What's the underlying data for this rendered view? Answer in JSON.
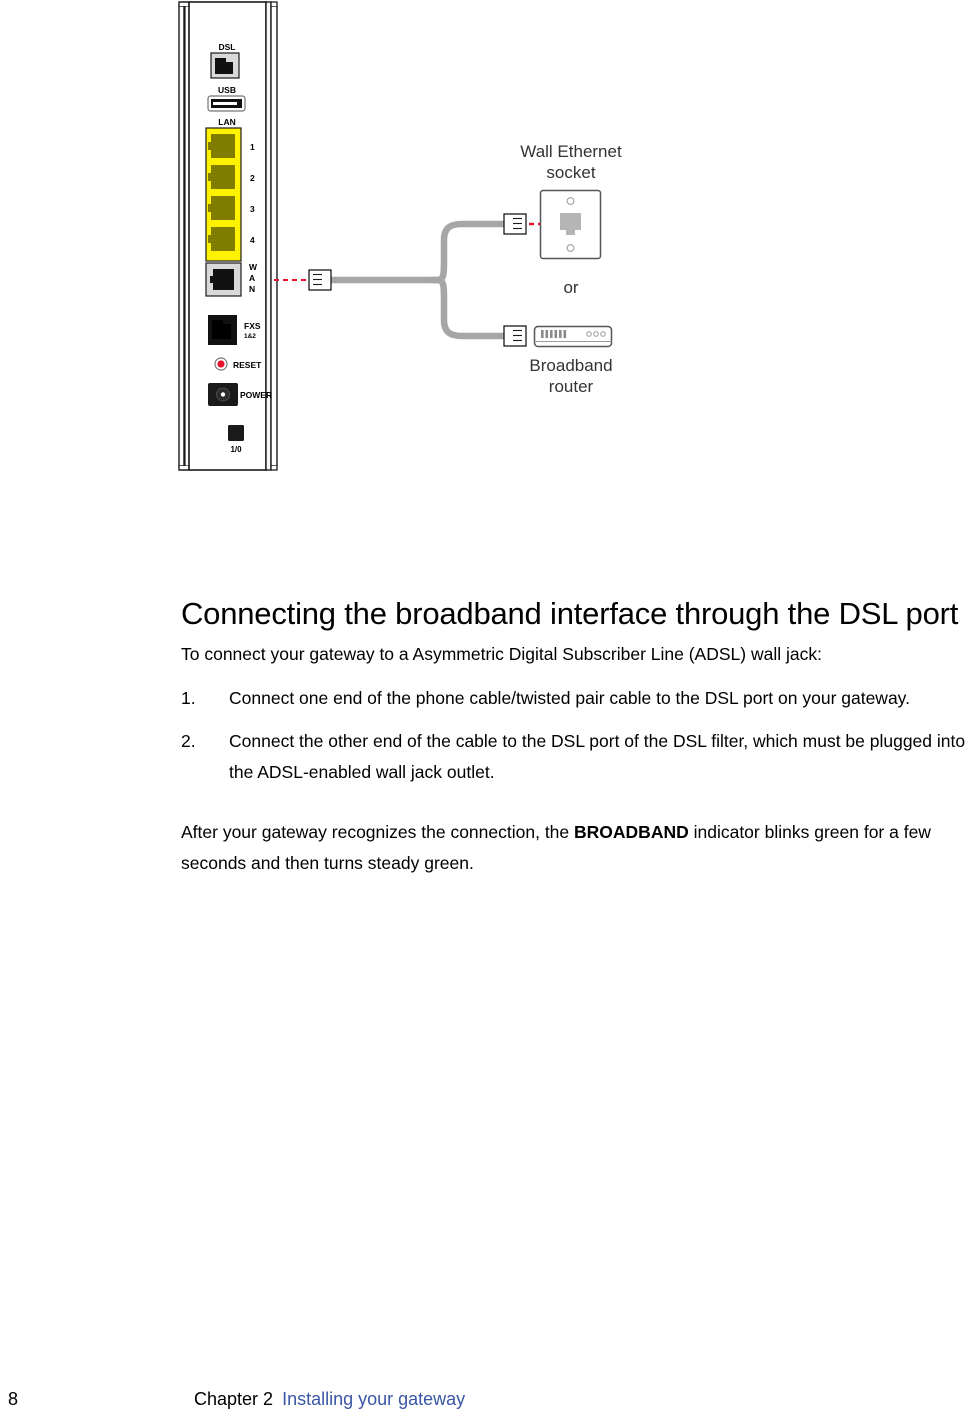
{
  "figure": {
    "device": {
      "name": "gateway-rear-panel",
      "ports": [
        {
          "id": "dsl",
          "label": "DSL",
          "type": "rj11-dark",
          "label_pos": "above"
        },
        {
          "id": "usb",
          "label": "USB",
          "type": "usb-a",
          "label_pos": "above"
        },
        {
          "id": "lan",
          "label": "LAN",
          "type": "lan-group",
          "label_pos": "above"
        },
        {
          "id": "lan1",
          "label": "1",
          "type": "rj45-yellow",
          "label_pos": "right"
        },
        {
          "id": "lan2",
          "label": "2",
          "type": "rj45-yellow",
          "label_pos": "right"
        },
        {
          "id": "lan3",
          "label": "3",
          "type": "rj45-yellow",
          "label_pos": "right"
        },
        {
          "id": "lan4",
          "label": "4",
          "type": "rj45-yellow",
          "label_pos": "right"
        },
        {
          "id": "wan",
          "label": "W\nA\nN",
          "type": "rj45-gray",
          "label_pos": "right"
        },
        {
          "id": "fxs",
          "label": "FXS",
          "sublabel": "1&2",
          "type": "rj11-dark",
          "label_pos": "right"
        },
        {
          "id": "reset",
          "label": "RESET",
          "type": "reset-button",
          "label_pos": "right"
        },
        {
          "id": "power",
          "label": "POWER",
          "type": "power-jack",
          "label_pos": "right"
        },
        {
          "id": "onoff",
          "label": "1/0",
          "type": "power-switch",
          "label_pos": "below"
        }
      ],
      "colors": {
        "lan_yellow": "#FFF200",
        "lan_jack": "#807c00",
        "port_dark": "#1a1a1a",
        "port_gray": "#d9d9d9",
        "outline": "#1a1a1a"
      }
    },
    "cable": {
      "name": "ethernet-cable",
      "color": "#a6a6a6",
      "split": "y-branch"
    },
    "connection_indicator": {
      "name": "red-dashed-connection",
      "color": "#e8112d",
      "style": "dashed"
    },
    "labels": {
      "wall_socket": "Wall Ethernet\nsocket",
      "or": "or",
      "broadband_router": "Broadband\nrouter"
    }
  },
  "content": {
    "heading": "Connecting the broadband interface through the DSL port",
    "intro": "To connect your gateway to a Asymmetric Digital Subscriber Line (ADSL) wall jack:",
    "steps": [
      {
        "number": "1.",
        "text": "Connect one end of the phone cable/twisted pair cable to the DSL port on your gateway."
      },
      {
        "number": "2.",
        "text": "Connect the other end of the cable to the DSL port of the DSL filter, which must be plugged into the ADSL-enabled wall jack outlet."
      }
    ],
    "closing": {
      "before_bold": "After your gateway recognizes the connection, the ",
      "bold": "BROADBAND",
      "after_bold": " indicator blinks green for a few seconds and then turns steady green."
    }
  },
  "footer": {
    "page_number": "8",
    "chapter": "Chapter 2",
    "chapter_title": "Installing your gateway",
    "link_color": "#3a56a5"
  }
}
